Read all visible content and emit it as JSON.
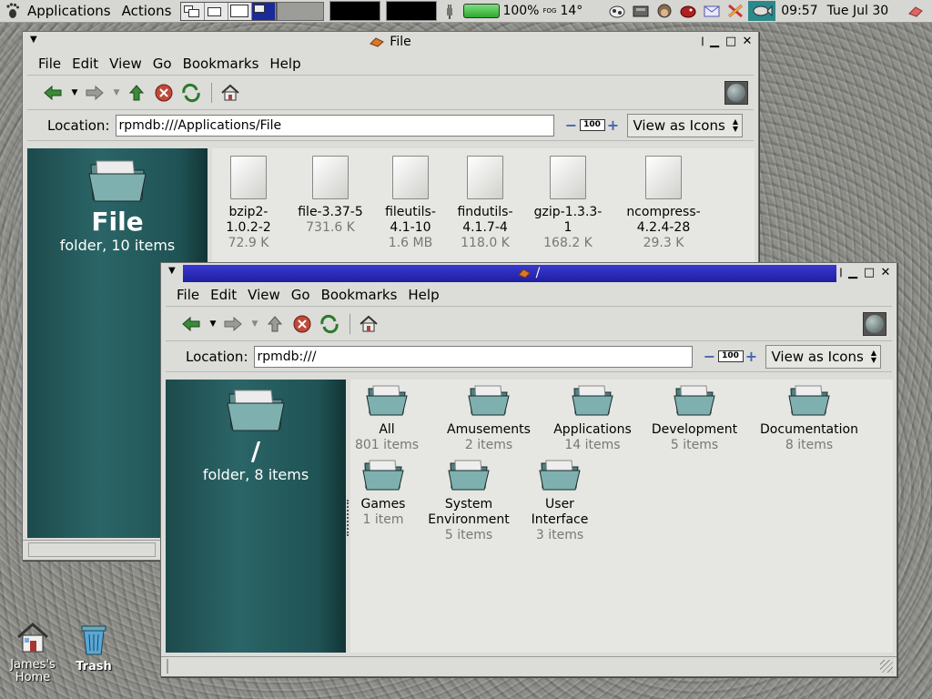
{
  "panel": {
    "menu_applications": "Applications",
    "menu_actions": "Actions",
    "battery_percent": "100%",
    "weather_label": "FOG",
    "temperature": "14°",
    "time": "09:57",
    "date": "Tue Jul 30"
  },
  "win_file": {
    "title": "File",
    "menus": [
      "File",
      "Edit",
      "View",
      "Go",
      "Bookmarks",
      "Help"
    ],
    "location_label": "Location:",
    "location_value": "rpmdb:///Applications/File",
    "zoom": "100",
    "view_mode": "View as Icons",
    "side_title": "File",
    "side_sub": "folder, 10 items",
    "items": [
      {
        "name": "bzip2-\n1.0.2-2",
        "size": "72.9 K"
      },
      {
        "name": "file-3.37-5",
        "size": "731.6 K"
      },
      {
        "name": "fileutils-\n4.1-10",
        "size": "1.6 MB"
      },
      {
        "name": "findutils-\n4.1.7-4",
        "size": "118.0 K"
      },
      {
        "name": "gzip-1.3.3-\n1",
        "size": "168.2 K"
      },
      {
        "name": "ncompress-\n4.2.4-28",
        "size": "29.3 K"
      }
    ]
  },
  "win_root": {
    "title": "/",
    "menus": [
      "File",
      "Edit",
      "View",
      "Go",
      "Bookmarks",
      "Help"
    ],
    "location_label": "Location:",
    "location_value": "rpmdb:///",
    "zoom": "100",
    "view_mode": "View as Icons",
    "side_title": "/",
    "side_sub": "folder, 8 items",
    "items": [
      {
        "name": "All",
        "count": "801 items"
      },
      {
        "name": "Amusements",
        "count": "2 items"
      },
      {
        "name": "Applications",
        "count": "14 items"
      },
      {
        "name": "Development",
        "count": "5 items"
      },
      {
        "name": "Documentation",
        "count": "8 items"
      },
      {
        "name": "Games",
        "count": "1 item"
      },
      {
        "name": "System\nEnvironment",
        "count": "5 items"
      },
      {
        "name": "User\nInterface",
        "count": "3 items"
      }
    ]
  },
  "desktop": {
    "home_label": "James's\nHome",
    "trash_label": "Trash"
  },
  "colors": {
    "active_title": "#2a2ab0",
    "sidebar": "#2b6567",
    "panel": "#d6d6d2"
  }
}
